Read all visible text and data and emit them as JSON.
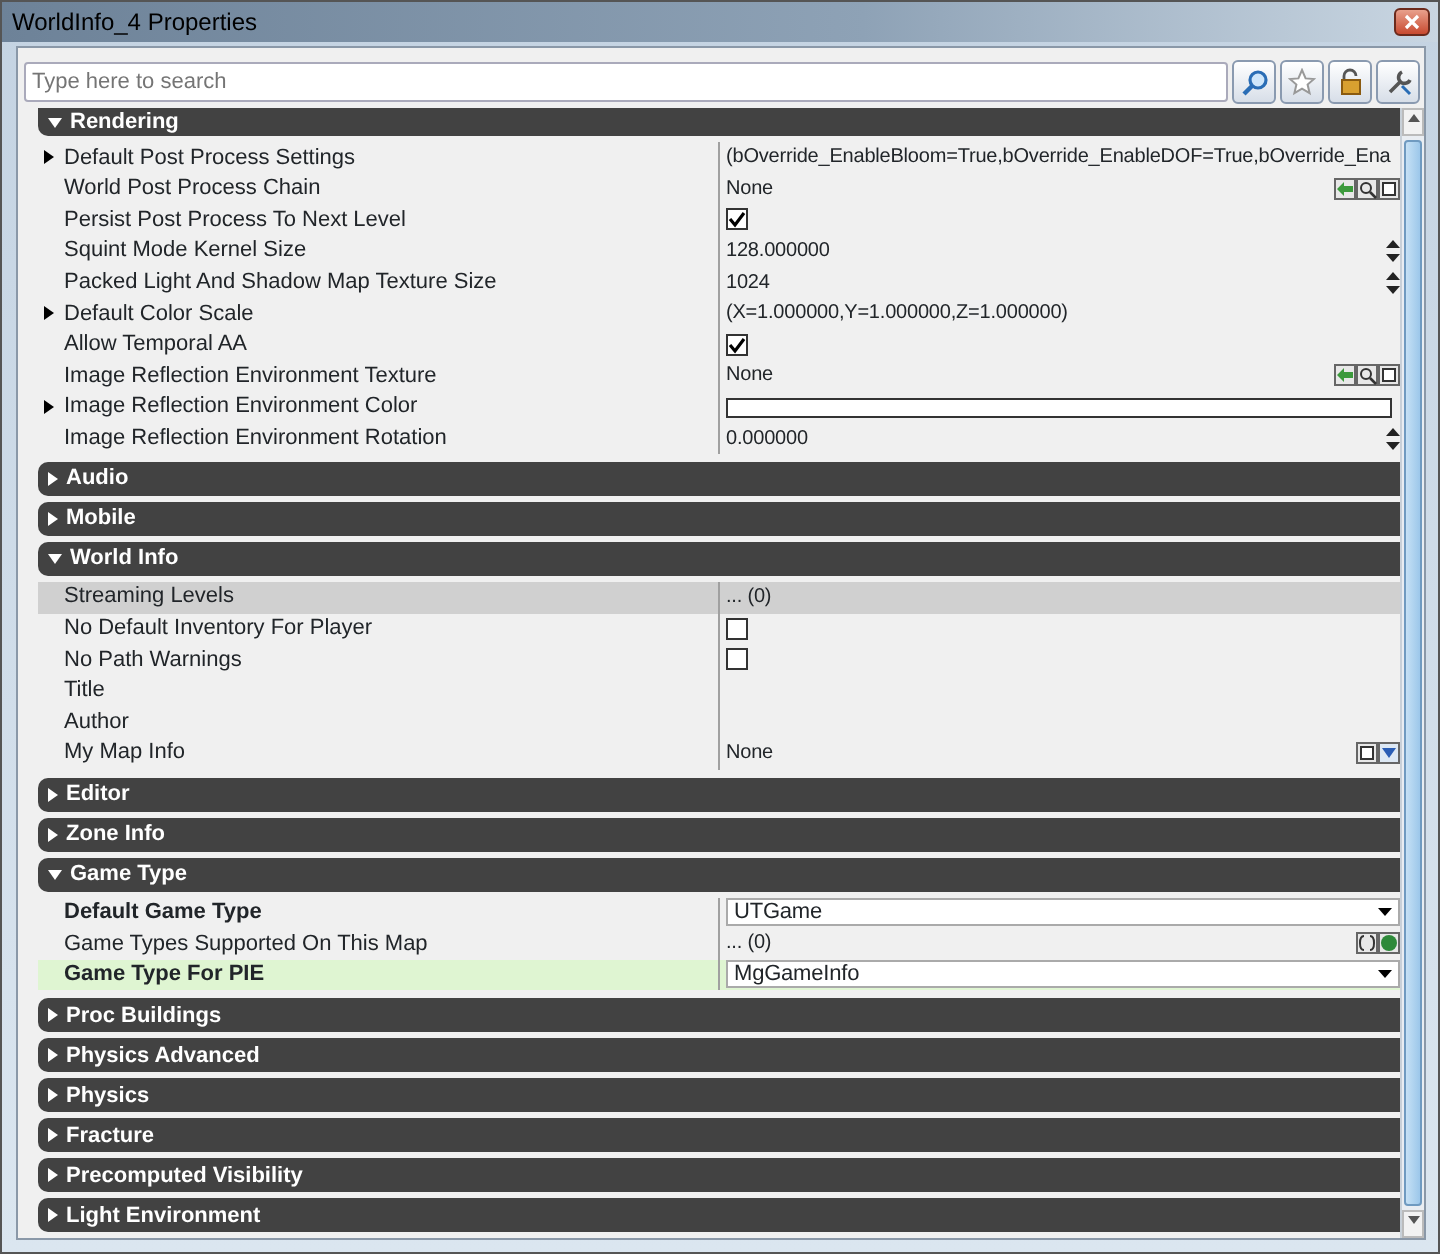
{
  "window": {
    "title": "WorldInfo_4 Properties"
  },
  "search": {
    "placeholder": "Type here to search"
  },
  "sections": [
    {
      "title": "Rendering",
      "expanded": true,
      "rows": [
        {
          "name": "Default Post Process Settings",
          "expandable": true,
          "selected": false,
          "modified": false,
          "focused": false,
          "kind": "text",
          "value": "(bOverride_EnableBloom=True,bOverride_EnableDOF=True,bOverride_Ena"
        },
        {
          "name": "World Post Process Chain",
          "expandable": false,
          "selected": false,
          "modified": false,
          "focused": false,
          "kind": "asset",
          "value": "None"
        },
        {
          "name": "Persist Post Process To Next Level",
          "expandable": false,
          "selected": false,
          "modified": false,
          "focused": false,
          "kind": "checkbox",
          "checked": true
        },
        {
          "name": "Squint Mode Kernel Size",
          "expandable": false,
          "selected": false,
          "modified": false,
          "focused": false,
          "kind": "spinner",
          "value": "128.000000"
        },
        {
          "name": "Packed Light And Shadow Map Texture Size",
          "expandable": false,
          "selected": false,
          "modified": false,
          "focused": false,
          "kind": "spinner",
          "value": "1024"
        },
        {
          "name": "Default Color Scale",
          "expandable": true,
          "selected": false,
          "modified": false,
          "focused": false,
          "kind": "text",
          "value": "(X=1.000000,Y=1.000000,Z=1.000000)"
        },
        {
          "name": "Allow Temporal AA",
          "expandable": false,
          "selected": false,
          "modified": false,
          "focused": false,
          "kind": "checkbox",
          "checked": true
        },
        {
          "name": "Image Reflection Environment Texture",
          "expandable": false,
          "selected": false,
          "modified": false,
          "focused": false,
          "kind": "asset",
          "value": "None"
        },
        {
          "name": "Image Reflection Environment Color",
          "expandable": true,
          "selected": false,
          "modified": false,
          "focused": false,
          "kind": "color"
        },
        {
          "name": "Image Reflection Environment Rotation",
          "expandable": false,
          "selected": false,
          "modified": false,
          "focused": false,
          "kind": "spinner",
          "value": "0.000000"
        }
      ]
    },
    {
      "title": "Audio",
      "expanded": false
    },
    {
      "title": "Mobile",
      "expanded": false
    },
    {
      "title": "World Info",
      "expanded": true,
      "rows": [
        {
          "name": "Streaming Levels",
          "expandable": false,
          "selected": true,
          "modified": false,
          "focused": false,
          "kind": "text",
          "value": "... (0)"
        },
        {
          "name": "No Default Inventory For Player",
          "expandable": false,
          "selected": false,
          "modified": false,
          "focused": false,
          "kind": "checkbox",
          "checked": false
        },
        {
          "name": "No Path Warnings",
          "expandable": false,
          "selected": false,
          "modified": false,
          "focused": false,
          "kind": "checkbox",
          "checked": false
        },
        {
          "name": "Title",
          "expandable": false,
          "selected": false,
          "modified": false,
          "focused": false,
          "kind": "text"
        },
        {
          "name": "Author",
          "expandable": false,
          "selected": false,
          "modified": false,
          "focused": false,
          "kind": "text"
        },
        {
          "name": "My Map Info",
          "expandable": false,
          "selected": false,
          "modified": false,
          "focused": false,
          "kind": "object",
          "value": "None"
        }
      ]
    },
    {
      "title": "Editor",
      "expanded": false
    },
    {
      "title": "Zone Info",
      "expanded": false
    },
    {
      "title": "Game Type",
      "expanded": true,
      "rows": [
        {
          "name": "Default Game Type",
          "expandable": false,
          "selected": false,
          "modified": true,
          "focused": false,
          "kind": "combo",
          "value": "UTGame"
        },
        {
          "name": "Game Types Supported On This Map",
          "expandable": false,
          "selected": false,
          "modified": false,
          "focused": false,
          "kind": "array",
          "value": "... (0)"
        },
        {
          "name": "Game Type For PIE",
          "expandable": false,
          "selected": false,
          "modified": true,
          "focused": true,
          "kind": "combo",
          "value": "MgGameInfo"
        }
      ]
    },
    {
      "title": "Proc Buildings",
      "expanded": false
    },
    {
      "title": "Physics Advanced",
      "expanded": false
    },
    {
      "title": "Physics",
      "expanded": false
    },
    {
      "title": "Fracture",
      "expanded": false
    },
    {
      "title": "Precomputed Visibility",
      "expanded": false
    },
    {
      "title": "Light Environment",
      "expanded": false
    }
  ]
}
